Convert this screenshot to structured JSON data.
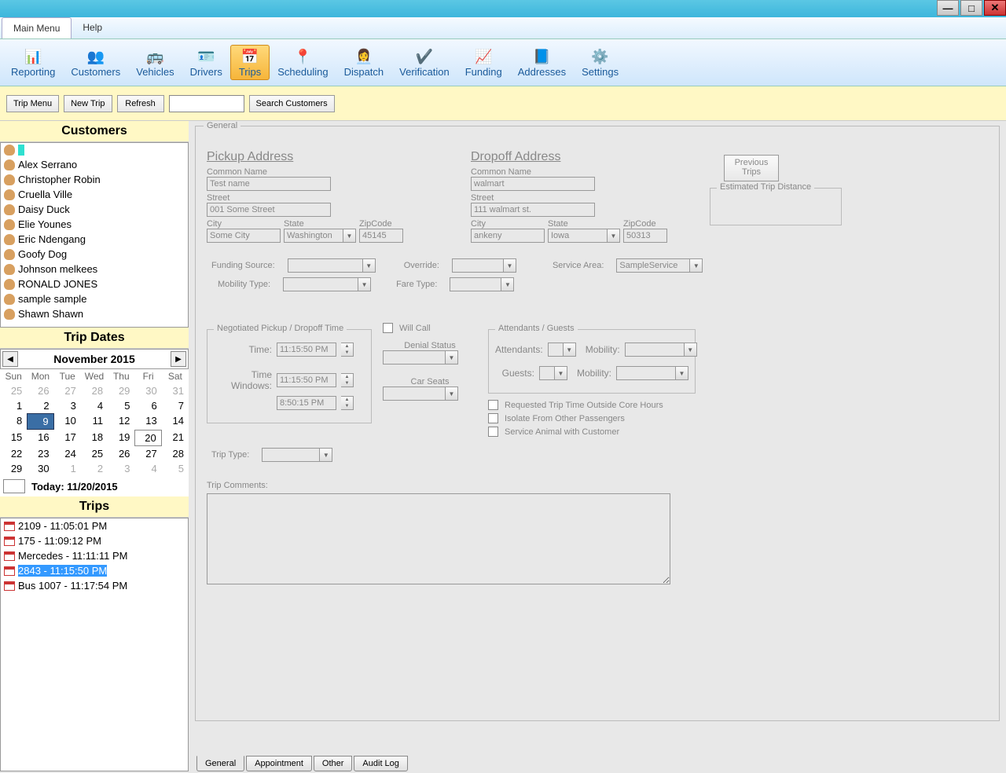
{
  "menus": {
    "main": "Main Menu",
    "help": "Help"
  },
  "ribbon": [
    {
      "label": "Reporting",
      "icon": "📊"
    },
    {
      "label": "Customers",
      "icon": "👥"
    },
    {
      "label": "Vehicles",
      "icon": "🚌"
    },
    {
      "label": "Drivers",
      "icon": "🪪"
    },
    {
      "label": "Trips",
      "icon": "📅",
      "active": true
    },
    {
      "label": "Scheduling",
      "icon": "📍"
    },
    {
      "label": "Dispatch",
      "icon": "👩‍💼"
    },
    {
      "label": "Verification",
      "icon": "✔️"
    },
    {
      "label": "Funding",
      "icon": "📈"
    },
    {
      "label": "Addresses",
      "icon": "📘"
    },
    {
      "label": "Settings",
      "icon": "⚙️"
    }
  ],
  "toolbar": {
    "trip_menu": "Trip Menu",
    "new_trip": "New Trip",
    "refresh": "Refresh",
    "search": "Search Customers",
    "search_value": ""
  },
  "headers": {
    "customers": "Customers",
    "trip_dates": "Trip Dates",
    "trips": "Trips"
  },
  "customers": [
    "Alex Serrano",
    "Christopher Robin",
    "Cruella Ville",
    "Daisy Duck",
    "Elie  Younes",
    "Eric Ndengang",
    "Goofy Dog",
    "Johnson melkees",
    "RONALD JONES",
    "sample sample",
    "Shawn Shawn"
  ],
  "calendar": {
    "title": "November 2015",
    "dow": [
      "Sun",
      "Mon",
      "Tue",
      "Wed",
      "Thu",
      "Fri",
      "Sat"
    ],
    "today_label": "Today: 11/20/2015",
    "selected": 9,
    "today": 20,
    "weeks": [
      [
        {
          "n": 25,
          "o": 1
        },
        {
          "n": 26,
          "o": 1
        },
        {
          "n": 27,
          "o": 1
        },
        {
          "n": 28,
          "o": 1
        },
        {
          "n": 29,
          "o": 1
        },
        {
          "n": 30,
          "o": 1
        },
        {
          "n": 31,
          "o": 1
        }
      ],
      [
        {
          "n": 1
        },
        {
          "n": 2
        },
        {
          "n": 3
        },
        {
          "n": 4
        },
        {
          "n": 5
        },
        {
          "n": 6
        },
        {
          "n": 7
        }
      ],
      [
        {
          "n": 8
        },
        {
          "n": 9
        },
        {
          "n": 10
        },
        {
          "n": 11
        },
        {
          "n": 12
        },
        {
          "n": 13
        },
        {
          "n": 14
        }
      ],
      [
        {
          "n": 15
        },
        {
          "n": 16
        },
        {
          "n": 17
        },
        {
          "n": 18
        },
        {
          "n": 19
        },
        {
          "n": 20
        },
        {
          "n": 21
        }
      ],
      [
        {
          "n": 22
        },
        {
          "n": 23
        },
        {
          "n": 24
        },
        {
          "n": 25
        },
        {
          "n": 26
        },
        {
          "n": 27
        },
        {
          "n": 28
        }
      ],
      [
        {
          "n": 29
        },
        {
          "n": 30
        },
        {
          "n": 1,
          "o": 1
        },
        {
          "n": 2,
          "o": 1
        },
        {
          "n": 3,
          "o": 1
        },
        {
          "n": 4,
          "o": 1
        },
        {
          "n": 5,
          "o": 1
        }
      ]
    ]
  },
  "trips": [
    {
      "text": "2109 - 11:05:01 PM"
    },
    {
      "text": "175 - 11:09:12 PM"
    },
    {
      "text": "Mercedes - 11:11:11 PM"
    },
    {
      "text": "2843 - 11:15:50 PM",
      "selected": true
    },
    {
      "text": "Bus 1007 - 11:17:54 PM"
    }
  ],
  "form": {
    "panel_title": "General",
    "pickup": {
      "title": "Pickup Address",
      "common_label": "Common Name",
      "common": "Test name",
      "street_label": "Street",
      "street": "001 Some Street",
      "city_label": "City",
      "city": "Some City",
      "state_label": "State",
      "state": "Washington",
      "zip_label": "ZipCode",
      "zip": "45145"
    },
    "dropoff": {
      "title": "Dropoff Address",
      "common_label": "Common Name",
      "common": "walmart",
      "street_label": "Street",
      "street": "111 walmart st.",
      "city_label": "City",
      "city": "ankeny",
      "state_label": "State",
      "state": "Iowa",
      "zip_label": "ZipCode",
      "zip": "50313"
    },
    "prev_trips": "Previous Trips",
    "est_dist": "Estimated Trip Distance",
    "funding_source": "Funding Source:",
    "override": "Override:",
    "service_area": "Service Area:",
    "service_area_val": "SampleService",
    "mobility_type": "Mobility Type:",
    "fare_type": "Fare Type:",
    "neg_title": "Negotiated  Pickup / Dropoff Time",
    "time_label": "Time:",
    "time_val": "11:15:50 PM",
    "time_windows": "Time Windows:",
    "tw1": "11:15:50 PM",
    "tw2": "8:50:15 PM",
    "trip_type": "Trip Type:",
    "will_call": "Will Call",
    "denial_status": "Denial Status",
    "car_seats": "Car Seats",
    "att_title": "Attendants / Guests",
    "attendants": "Attendants:",
    "guests": "Guests:",
    "mobility": "Mobility:",
    "req_outside": "Requested Trip Time Outside Core Hours",
    "isolate": "Isolate From Other Passengers",
    "service_animal": "Service Animal with Customer",
    "comments_label": "Trip Comments:"
  },
  "bottom_tabs": [
    "General",
    "Appointment",
    "Other",
    "Audit Log"
  ]
}
